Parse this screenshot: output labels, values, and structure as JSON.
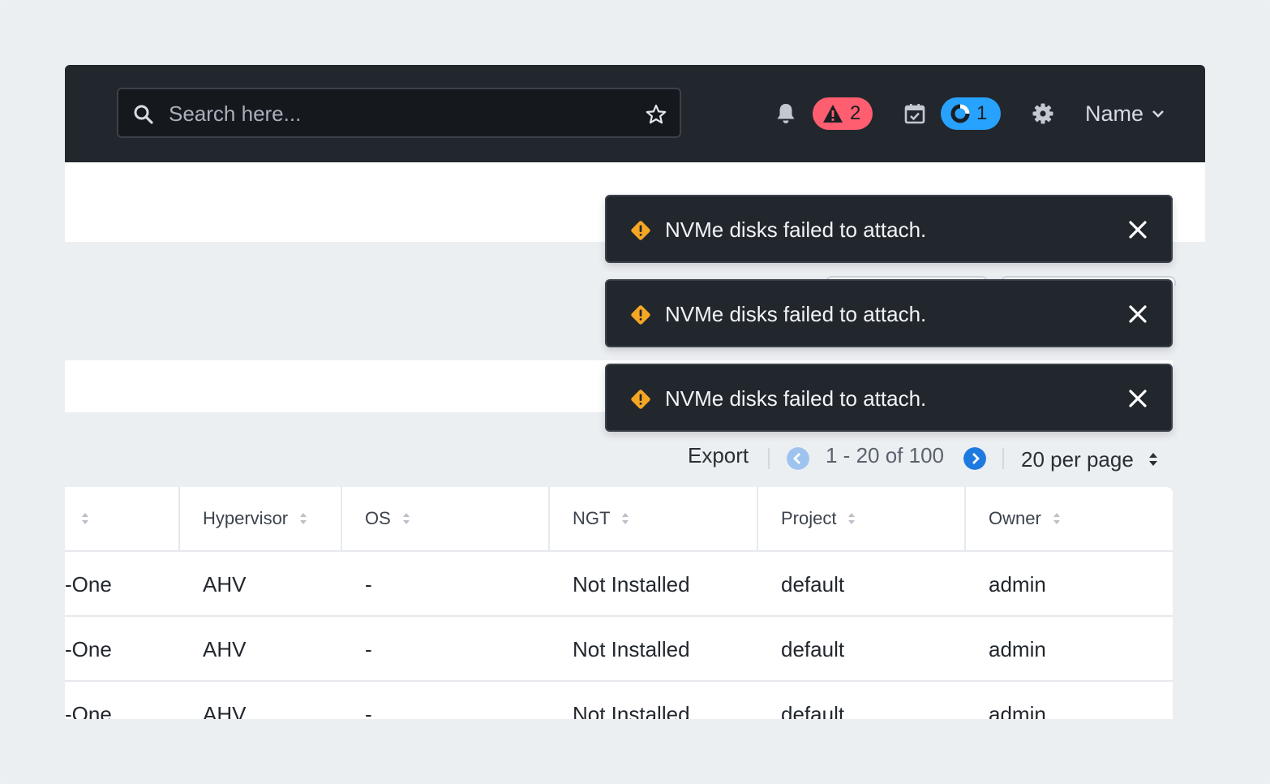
{
  "header": {
    "search_placeholder": "Search here...",
    "alerts_count": "2",
    "tasks_count": "1",
    "user_label": "Name"
  },
  "toasts": [
    {
      "message": "NVMe disks failed to attach."
    },
    {
      "message": "NVMe disks failed to attach."
    },
    {
      "message": "NVMe disks failed to attach."
    }
  ],
  "pagination": {
    "export_label": "Export",
    "range": "1 - 20 of 100",
    "per_page": "20 per page"
  },
  "table": {
    "columns": [
      "",
      "Hypervisor",
      "OS",
      "NGT",
      "Project",
      "Owner"
    ],
    "rows": [
      [
        "-One",
        "AHV",
        "-",
        "Not Installed",
        "default",
        "admin"
      ],
      [
        "-One",
        "AHV",
        "-",
        "Not Installed",
        "default",
        "admin"
      ],
      [
        "-One",
        "AHV",
        "-",
        "Not Installed",
        "default",
        "admin"
      ]
    ]
  },
  "colors": {
    "topbar": "#22272e",
    "alert_badge": "#ff5e70",
    "task_badge": "#27a2ff",
    "warning": "#f5a623",
    "pager_blue": "#1f7ae0"
  }
}
